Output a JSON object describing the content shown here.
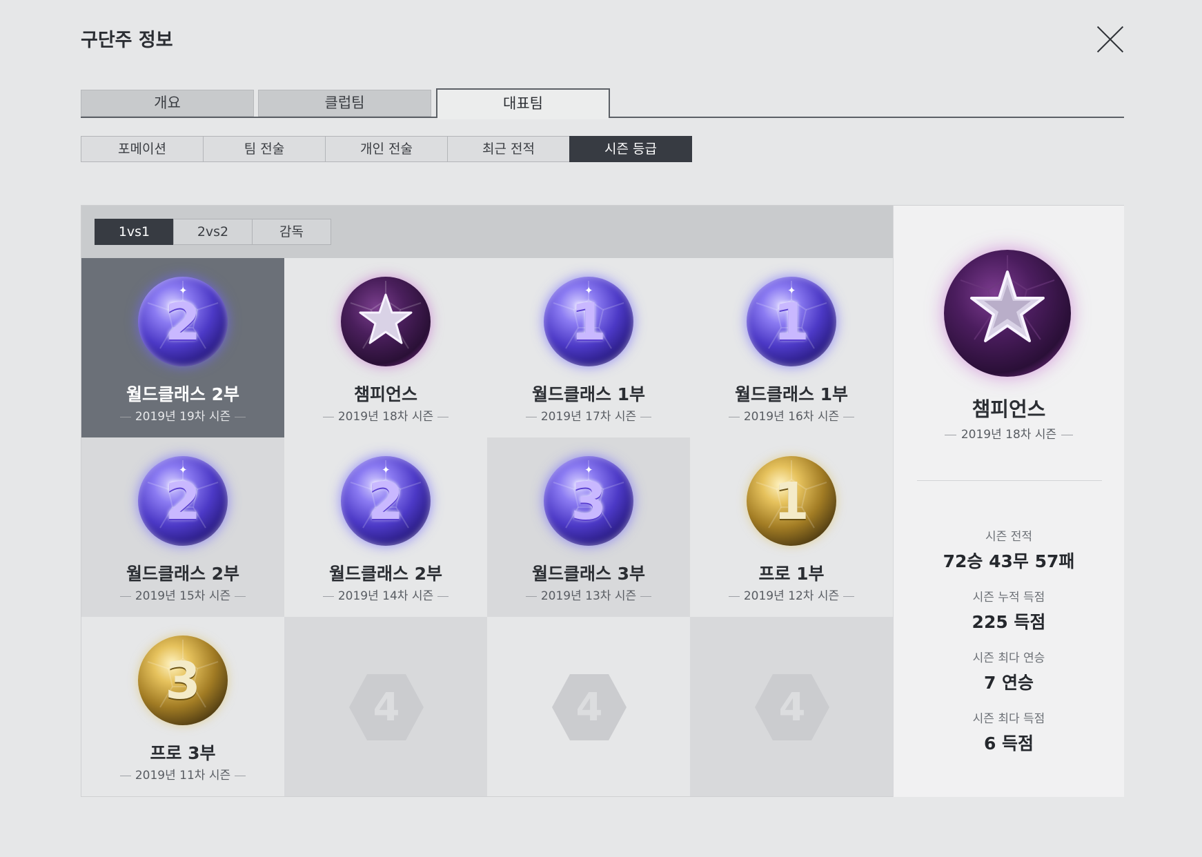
{
  "title": "구단주 정보",
  "main_tabs": [
    "개요",
    "클럽팀",
    "대표팀"
  ],
  "sub_tabs": [
    "포메이션",
    "팀 전술",
    "개인 전술",
    "최근 전적",
    "시즌 등급"
  ],
  "mode_tabs": [
    "1vs1",
    "2vs2",
    "감독"
  ],
  "ranks": [
    {
      "name": "월드클래스 2부",
      "season": "2019년 19차 시즌",
      "badge": "purple",
      "glyph": "2",
      "selected": true
    },
    {
      "name": "챔피언스",
      "season": "2019년 18차 시즌",
      "badge": "champ",
      "glyph": "★"
    },
    {
      "name": "월드클래스 1부",
      "season": "2019년 17차 시즌",
      "badge": "purple",
      "glyph": "1"
    },
    {
      "name": "월드클래스 1부",
      "season": "2019년 16차 시즌",
      "badge": "purple",
      "glyph": "1"
    },
    {
      "name": "월드클래스 2부",
      "season": "2019년 15차 시즌",
      "badge": "purple",
      "glyph": "2"
    },
    {
      "name": "월드클래스 2부",
      "season": "2019년 14차 시즌",
      "badge": "purple",
      "glyph": "2"
    },
    {
      "name": "월드클래스 3부",
      "season": "2019년 13차 시즌",
      "badge": "purple",
      "glyph": "3"
    },
    {
      "name": "프로 1부",
      "season": "2019년 12차 시즌",
      "badge": "gold",
      "glyph": "1"
    },
    {
      "name": "프로 3부",
      "season": "2019년 11차 시즌",
      "badge": "gold",
      "glyph": "3"
    }
  ],
  "empty_slot_glyph": "4",
  "detail": {
    "name": "챔피언스",
    "season": "2019년 18차 시즌",
    "stats": [
      {
        "label": "시즌 전적",
        "value": "72승 43무 57패"
      },
      {
        "label": "시즌 누적 득점",
        "value": "225 득점"
      },
      {
        "label": "시즌 최다 연승",
        "value": "7 연승"
      },
      {
        "label": "시즌 최다 득점",
        "value": "6 득점"
      }
    ]
  }
}
